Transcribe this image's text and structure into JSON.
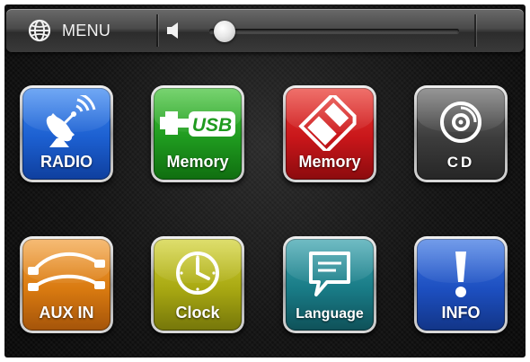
{
  "topbar": {
    "menu_label": "MENU",
    "menu_icon": "globe-icon",
    "volume_icon": "speaker-icon",
    "volume_level": 0.06
  },
  "tiles": [
    {
      "id": "radio",
      "label": "RADIO",
      "icon": "satellite-dish-icon",
      "color": "#1c5fd0"
    },
    {
      "id": "usb",
      "label": "Memory",
      "icon": "usb-icon",
      "color": "#1f9a1f"
    },
    {
      "id": "sd",
      "label": "Memory",
      "icon": "sd-card-icon",
      "color": "#c8161a"
    },
    {
      "id": "cd",
      "label": "CD",
      "icon": "disc-icon",
      "color": "#4a4a4a"
    },
    {
      "id": "aux",
      "label": "AUX IN",
      "icon": "aux-cable-icon",
      "color": "#d97a10"
    },
    {
      "id": "clock",
      "label": "Clock",
      "icon": "clock-icon",
      "color": "#a8a812"
    },
    {
      "id": "language",
      "label": "Language",
      "icon": "speech-bubble-icon",
      "color": "#197b86"
    },
    {
      "id": "info",
      "label": "INFO",
      "icon": "exclamation-icon",
      "color": "#1d4fc0"
    }
  ]
}
